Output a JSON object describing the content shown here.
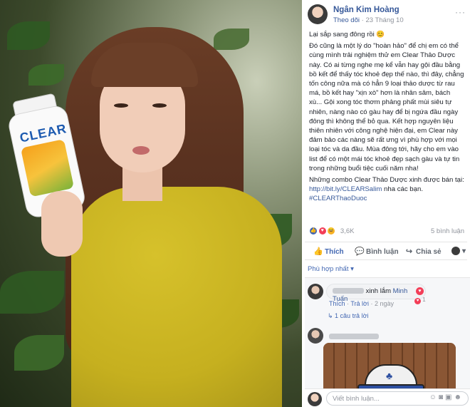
{
  "post": {
    "author": "Ngân Kim Hoàng",
    "follow_label": "Theo dõi",
    "timestamp": "23 Tháng 10",
    "more_label": "···",
    "paragraphs": [
      "Lại sắp sang đông rồi 😊",
      "Đó cũng là một lý do \"hoàn hảo\" để chị em có thể cùng mình trải nghiệm thử em Clear Thảo Dược này. Có ai từng nghe mẹ kể vẫn hay gội đầu bằng bồ kết để thấy tóc khoẻ đẹp thế nào, thì đây, chẳng tốn công nữa mà có hẳn 9 loại thảo dược từ rau má, bồ kết hay \"xịn xò\" hơn là nhân sâm, bách xù... Gội xong tóc thơm phảng phất mùi siêu tự nhiên, nàng nào có gàu hay để bị ngứa đầu ngày đông thì không thể bỏ qua. Kết hợp nguyên liệu thiên nhiên với công nghệ hiện đại, em Clear này đảm bảo các nàng sẽ rất ưng vì phù hợp với mọi loại tóc và da đầu. Mùa đông tới, hãy cho em vào list để có một mái tóc khoẻ đẹp sạch gàu và tự tin trong những buổi tiệc cuối năm nha!",
      "Những combo Clear Thảo Dược xinh được bán tại:"
    ],
    "link": "http://bit.ly/CLEARSalim",
    "link_suffix": " nha các bạn.",
    "hashtag": "#CLEARThaoDuoc"
  },
  "reactions": {
    "count": "3,6K",
    "comments": "5 bình luận"
  },
  "actions": {
    "like": "Thích",
    "comment": "Bình luận",
    "share": "Chia sẻ"
  },
  "comments_filter": "Phù hợp nhất",
  "comments": [
    {
      "text_suffix": "xinh lắm ",
      "tag": "Minh Tuấn",
      "like": "Thích",
      "reply": "Trả lời",
      "age": "2 ngày",
      "reaction_count": "1",
      "replies": "1 câu trả lời"
    }
  ],
  "composer": {
    "placeholder": "Viết bình luận..."
  },
  "photo": {
    "bottle_brand": "CLEAR"
  },
  "colors": {
    "link": "#365899",
    "accent": "#4267b2",
    "muted": "#90949c",
    "sweater": "#c6b01f"
  },
  "icons": {
    "like": "thumbs-up-icon",
    "comment": "speech-bubble-icon",
    "share": "share-arrow-icon"
  }
}
